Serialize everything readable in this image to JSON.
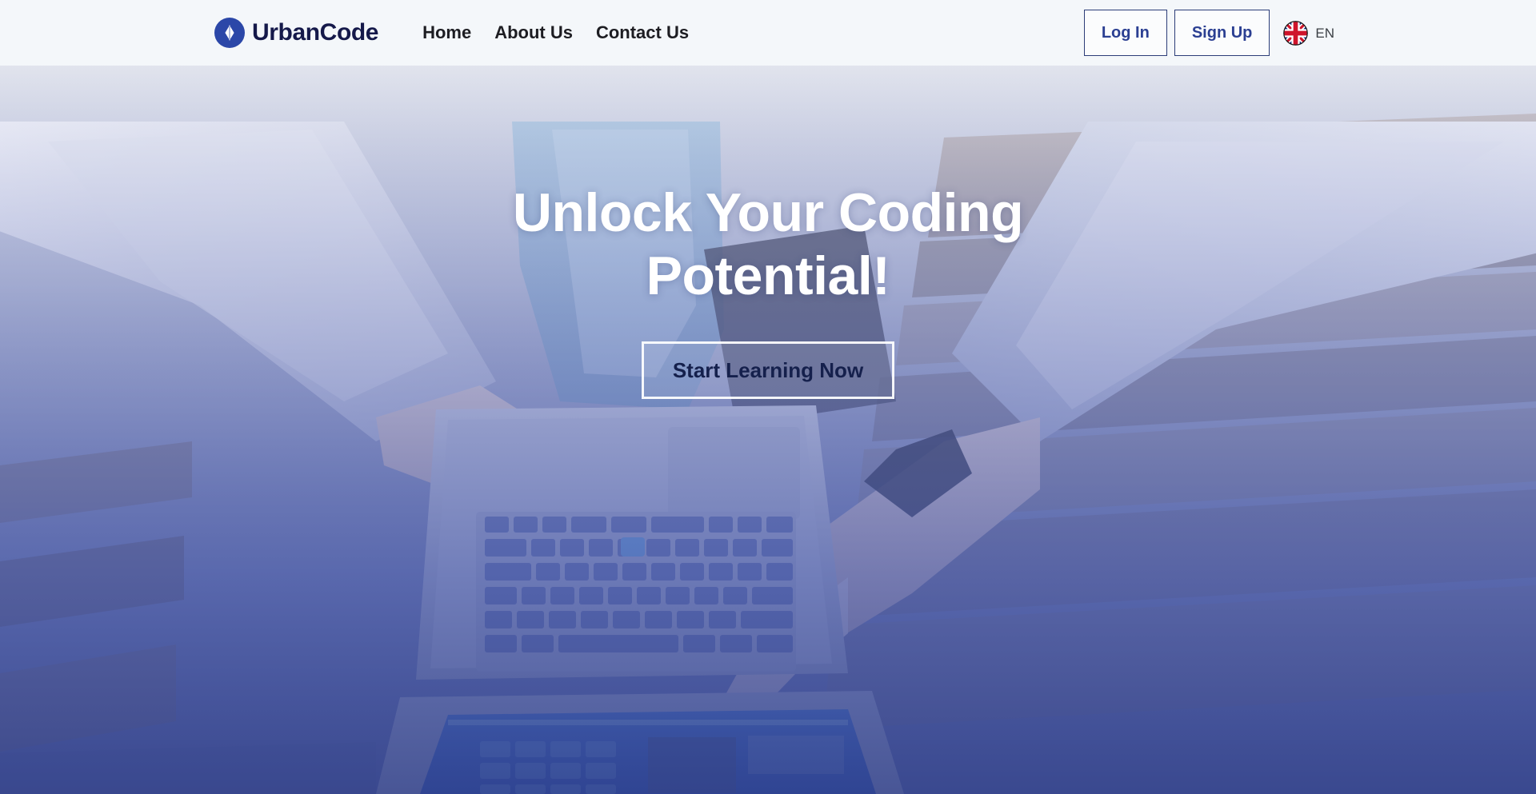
{
  "header": {
    "brand": {
      "name": "UrbanCode",
      "logo_icon": "code-chevrons-circle-icon",
      "logo_color": "#2b47a8"
    },
    "nav": [
      {
        "label": "Home"
      },
      {
        "label": "About Us"
      },
      {
        "label": "Contact Us"
      }
    ],
    "auth": {
      "login_label": "Log In",
      "signup_label": "Sign Up",
      "border_color": "#2c3d78",
      "text_color": "#2b3f92"
    },
    "language": {
      "code": "EN",
      "flag_icon": "uk-flag-icon"
    },
    "background_color": "#f4f7fa"
  },
  "hero": {
    "title": "Unlock Your Coding Potential!",
    "cta_label": "Start Learning Now",
    "cta_text_color": "#15204c",
    "overlay_color_top": "#7481c4",
    "overlay_color_bottom": "#32418a",
    "photo_description": "Overhead photo of three people at a wooden bench, hands pointing at a silver laptop keyboard with a glowing blue screen"
  }
}
